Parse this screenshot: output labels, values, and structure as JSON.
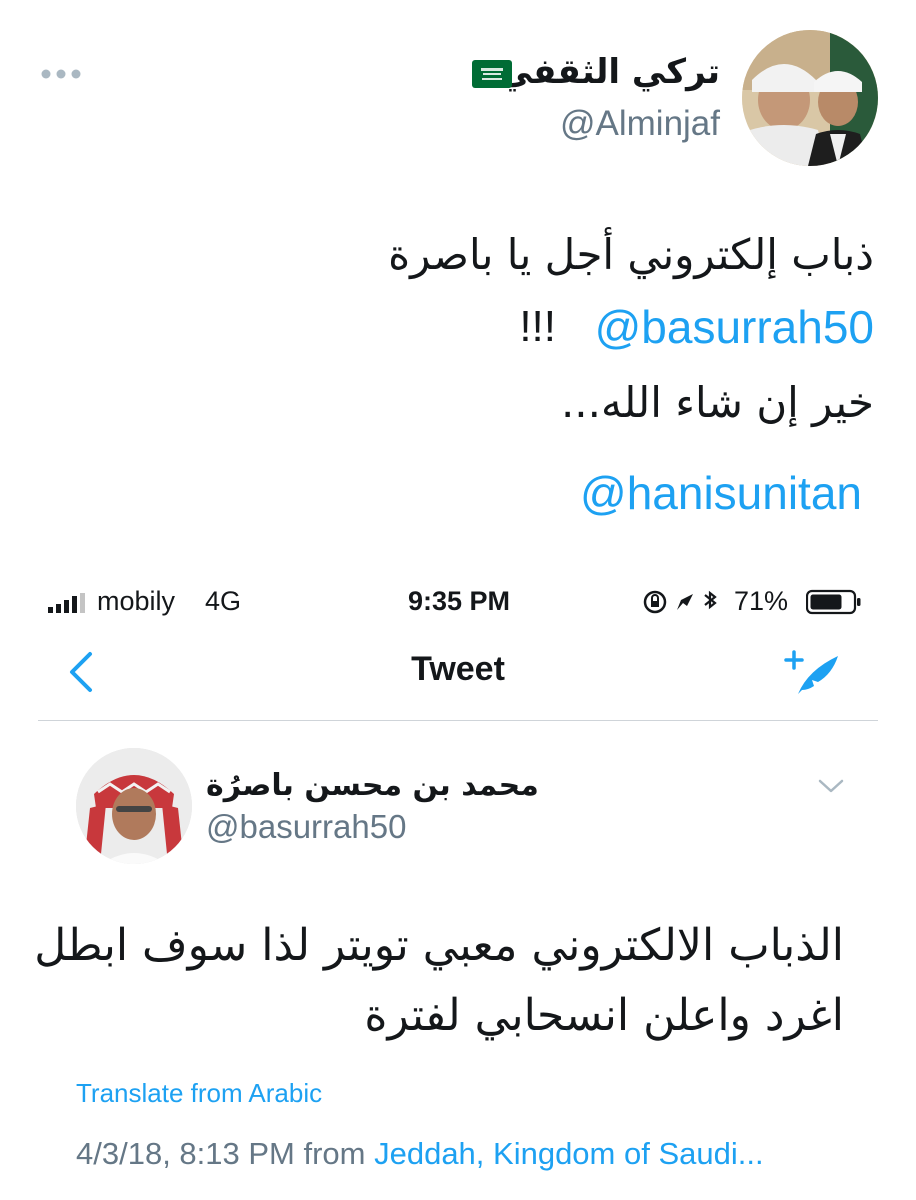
{
  "outer_tweet": {
    "name": "تركي الثقفي",
    "handle": "@Alminjaf",
    "body": {
      "line1": "ذباب إلكتروني أجل يا باصرة",
      "line2_mention": "@basurrah50",
      "line2_excl": "!!!",
      "line3": "خير إن شاء الله...",
      "mention2": "@hanisunitan"
    }
  },
  "status_bar": {
    "carrier": "mobily",
    "network": "4G",
    "time": "9:35 PM",
    "battery": "71%"
  },
  "nav": {
    "title": "Tweet"
  },
  "inner_tweet": {
    "name": "محمد بن محسن باصرُة",
    "handle": "@basurrah50",
    "body": {
      "line1": "الذباب الالكتروني معبي تويتر لذا سوف ابطل",
      "line2": "اغرد واعلن انسحابي لفترة"
    },
    "translate": "Translate from Arabic",
    "timestamp": "4/3/18, 8:13 PM from ",
    "location": "Jeddah, Kingdom of Saudi..."
  },
  "colors": {
    "link": "#1da1f2",
    "secondary_text": "#657786",
    "flag_green": "#006c35"
  },
  "icons": [
    "flag-icon",
    "more-icon",
    "signal-icon",
    "status-icons",
    "battery-icon",
    "back-icon",
    "compose-icon",
    "chevron-down-icon"
  ]
}
